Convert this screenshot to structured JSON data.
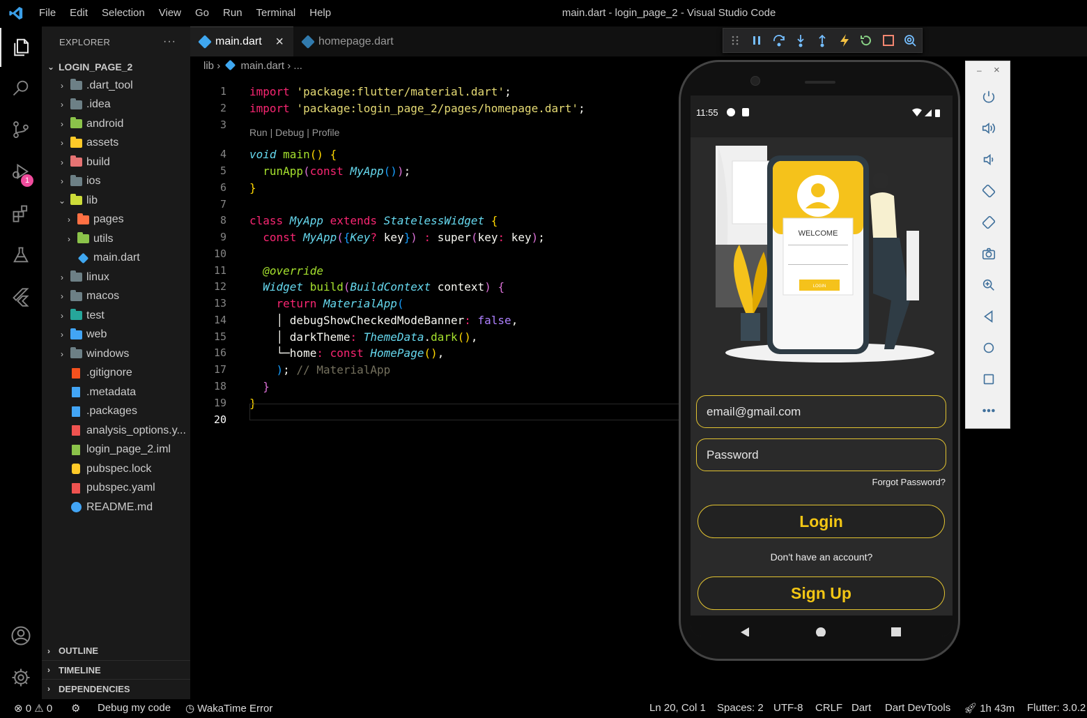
{
  "window": {
    "title": "main.dart - login_page_2 - Visual Studio Code",
    "menu": [
      "File",
      "Edit",
      "Selection",
      "View",
      "Go",
      "Run",
      "Terminal",
      "Help"
    ]
  },
  "activity_bar": {
    "items": [
      "explorer-icon",
      "search-icon",
      "source-control-icon",
      "run-debug-icon",
      "extensions-icon",
      "testing-icon",
      "flutter-icon"
    ],
    "debug_badge": "1",
    "bottom": [
      "account-icon",
      "settings-gear-icon"
    ]
  },
  "sidebar": {
    "title": "EXPLORER",
    "more": "···",
    "project": "LOGIN_PAGE_2",
    "tree": [
      {
        "label": ".dart_tool",
        "type": "folder",
        "depth": 1,
        "color": "#6d8086",
        "expanded": false
      },
      {
        "label": ".idea",
        "type": "folder",
        "depth": 1,
        "color": "#6d8086",
        "expanded": false
      },
      {
        "label": "android",
        "type": "folder",
        "depth": 1,
        "color": "#8bc34a",
        "expanded": false
      },
      {
        "label": "assets",
        "type": "folder",
        "depth": 1,
        "color": "#ffca28",
        "expanded": false
      },
      {
        "label": "build",
        "type": "folder",
        "depth": 1,
        "color": "#e57373",
        "expanded": false
      },
      {
        "label": "ios",
        "type": "folder",
        "depth": 1,
        "color": "#6d8086",
        "expanded": false
      },
      {
        "label": "lib",
        "type": "folder",
        "depth": 1,
        "color": "#cddc39",
        "expanded": true
      },
      {
        "label": "pages",
        "type": "folder",
        "depth": 2,
        "color": "#ff7043",
        "expanded": false
      },
      {
        "label": "utils",
        "type": "folder",
        "depth": 2,
        "color": "#8bc34a",
        "expanded": false
      },
      {
        "label": "main.dart",
        "type": "dart",
        "depth": 2,
        "color": "#3fa7f0"
      },
      {
        "label": "linux",
        "type": "folder",
        "depth": 1,
        "color": "#6d8086",
        "expanded": false
      },
      {
        "label": "macos",
        "type": "folder",
        "depth": 1,
        "color": "#6d8086",
        "expanded": false
      },
      {
        "label": "test",
        "type": "folder",
        "depth": 1,
        "color": "#26a69a",
        "expanded": false
      },
      {
        "label": "web",
        "type": "folder",
        "depth": 1,
        "color": "#42a5f5",
        "expanded": false
      },
      {
        "label": "windows",
        "type": "folder",
        "depth": 1,
        "color": "#6d8086",
        "expanded": false
      },
      {
        "label": ".gitignore",
        "type": "file",
        "depth": 1,
        "color": "#f4511e"
      },
      {
        "label": ".metadata",
        "type": "file",
        "depth": 1,
        "color": "#42a5f5"
      },
      {
        "label": ".packages",
        "type": "file",
        "depth": 1,
        "color": "#42a5f5"
      },
      {
        "label": "analysis_options.y...",
        "type": "file",
        "depth": 1,
        "color": "#ef5350"
      },
      {
        "label": "login_page_2.iml",
        "type": "file",
        "depth": 1,
        "color": "#8bc34a"
      },
      {
        "label": "pubspec.lock",
        "type": "lock",
        "depth": 1,
        "color": "#ffca28"
      },
      {
        "label": "pubspec.yaml",
        "type": "file",
        "depth": 1,
        "color": "#ef5350"
      },
      {
        "label": "README.md",
        "type": "info",
        "depth": 1,
        "color": "#42a5f5"
      }
    ],
    "sections": [
      "OUTLINE",
      "TIMELINE",
      "DEPENDENCIES"
    ]
  },
  "tabs": [
    {
      "label": "main.dart",
      "active": true,
      "close": "×"
    },
    {
      "label": "homepage.dart",
      "active": false
    }
  ],
  "breadcrumb": {
    "folder": "lib",
    "file": "main.dart",
    "rest": "..."
  },
  "editor": {
    "codelens": "Run | Debug | Profile",
    "current_line": 20,
    "lines": [
      {
        "n": "1",
        "tokens": [
          [
            "kw",
            "import "
          ],
          [
            "str",
            "'package:flutter/material.dart'"
          ],
          [
            "pl",
            ";"
          ]
        ]
      },
      {
        "n": "2",
        "tokens": [
          [
            "kw",
            "import "
          ],
          [
            "str",
            "'package:login_page_2/pages/homepage.dart'"
          ],
          [
            "pl",
            ";"
          ]
        ]
      },
      {
        "n": "3",
        "tokens": []
      },
      {
        "n": "4",
        "tokens": [
          [
            "cls",
            "void "
          ],
          [
            "fn",
            "main"
          ],
          [
            "br1",
            "() {"
          ]
        ]
      },
      {
        "n": "5",
        "tokens": [
          [
            "pl",
            "  "
          ],
          [
            "fn",
            "runApp"
          ],
          [
            "br2",
            "("
          ],
          [
            "kw",
            "const "
          ],
          [
            "cls",
            "MyApp"
          ],
          [
            "br3",
            "()"
          ],
          [
            "br2",
            ")"
          ],
          [
            "pl",
            ";"
          ]
        ]
      },
      {
        "n": "6",
        "tokens": [
          [
            "br1",
            "}"
          ]
        ]
      },
      {
        "n": "7",
        "tokens": []
      },
      {
        "n": "8",
        "tokens": [
          [
            "kw",
            "class "
          ],
          [
            "cls",
            "MyApp "
          ],
          [
            "kw",
            "extends "
          ],
          [
            "cls",
            "StatelessWidget "
          ],
          [
            "br1",
            "{"
          ]
        ]
      },
      {
        "n": "9",
        "tokens": [
          [
            "pl",
            "  "
          ],
          [
            "kw",
            "const "
          ],
          [
            "cls",
            "MyApp"
          ],
          [
            "br2",
            "("
          ],
          [
            "br3",
            "{"
          ],
          [
            "cls",
            "Key"
          ],
          [
            "kw",
            "? "
          ],
          [
            "pl",
            "key"
          ],
          [
            "br3",
            "}"
          ],
          [
            "br2",
            ") "
          ],
          [
            "kw",
            ": "
          ],
          [
            "pl",
            "super"
          ],
          [
            "br2",
            "("
          ],
          [
            "pl",
            "key"
          ],
          [
            "kw",
            ": "
          ],
          [
            "pl",
            "key"
          ],
          [
            "br2",
            ")"
          ],
          [
            "pl",
            ";"
          ]
        ]
      },
      {
        "n": "10",
        "tokens": []
      },
      {
        "n": "11",
        "tokens": [
          [
            "pl",
            "  "
          ],
          [
            "ann",
            "@override"
          ]
        ]
      },
      {
        "n": "12",
        "tokens": [
          [
            "pl",
            "  "
          ],
          [
            "cls",
            "Widget "
          ],
          [
            "fn",
            "build"
          ],
          [
            "br2",
            "("
          ],
          [
            "cls",
            "BuildContext "
          ],
          [
            "pl",
            "context"
          ],
          [
            "br2",
            ") "
          ],
          [
            "br2",
            "{"
          ]
        ]
      },
      {
        "n": "13",
        "tokens": [
          [
            "pl",
            "    "
          ],
          [
            "kw",
            "return "
          ],
          [
            "cls",
            "MaterialApp"
          ],
          [
            "br3",
            "("
          ]
        ]
      },
      {
        "n": "14",
        "tokens": [
          [
            "pl",
            "    │ debugShowCheckedModeBanner"
          ],
          [
            "kw",
            ": "
          ],
          [
            "bool",
            "false"
          ],
          [
            "pl",
            ","
          ]
        ]
      },
      {
        "n": "15",
        "tokens": [
          [
            "pl",
            "    │ darkTheme"
          ],
          [
            "kw",
            ": "
          ],
          [
            "cls",
            "ThemeData"
          ],
          [
            "pl",
            "."
          ],
          [
            "fn",
            "dark"
          ],
          [
            "br1",
            "()"
          ],
          [
            "pl",
            ","
          ]
        ]
      },
      {
        "n": "16",
        "tokens": [
          [
            "pl",
            "    └─home"
          ],
          [
            "kw",
            ": "
          ],
          [
            "kw",
            "const "
          ],
          [
            "cls",
            "HomePage"
          ],
          [
            "br1",
            "()"
          ],
          [
            "pl",
            ","
          ]
        ]
      },
      {
        "n": "17",
        "tokens": [
          [
            "pl",
            "    "
          ],
          [
            "br3",
            ")"
          ],
          [
            "pl",
            "; "
          ],
          [
            "cm",
            "// MaterialApp"
          ]
        ]
      },
      {
        "n": "18",
        "tokens": [
          [
            "pl",
            "  "
          ],
          [
            "br2",
            "}"
          ]
        ]
      },
      {
        "n": "19",
        "tokens": [
          [
            "br1",
            "}"
          ]
        ]
      },
      {
        "n": "20",
        "tokens": []
      }
    ]
  },
  "debug_toolbar": [
    "drag-handle-icon",
    "pause-icon",
    "step-over-icon",
    "step-into-icon",
    "step-out-icon",
    "hot-reload-icon",
    "hot-restart-icon",
    "stop-icon",
    "inspect-icon"
  ],
  "phone": {
    "time": "11:55",
    "illustration": {
      "welcome": "WELCOME",
      "login_small": "LOGIN"
    },
    "email_placeholder": "email@gmail.com",
    "password_placeholder": "Password",
    "forgot": "Forgot Password?",
    "login": "Login",
    "no_account": "Don't have an account?",
    "signup": "Sign Up"
  },
  "emulator_panel": {
    "min": "–",
    "close": "×",
    "buttons": [
      "power-icon",
      "volume-up-icon",
      "volume-down-icon",
      "rotate-left-icon",
      "rotate-right-icon",
      "camera-icon",
      "zoom-icon",
      "back-icon",
      "home-icon",
      "overview-icon",
      "more-icon"
    ]
  },
  "status_bar": {
    "errors": "0",
    "warnings": "0",
    "debug": "Debug my code",
    "wakatime": "WakaTime Error",
    "position": "Ln 20, Col 1",
    "spaces": "Spaces: 2",
    "encoding": "UTF-8",
    "eol": "CRLF",
    "language": "Dart",
    "devtools": "Dart DevTools",
    "time": "1h 43m",
    "flutter": "Flutter: 3.0.2"
  },
  "colors": {
    "accent": "#e3c431",
    "editor_bg": "#000000",
    "sidebar_bg": "#1a1a1a"
  }
}
